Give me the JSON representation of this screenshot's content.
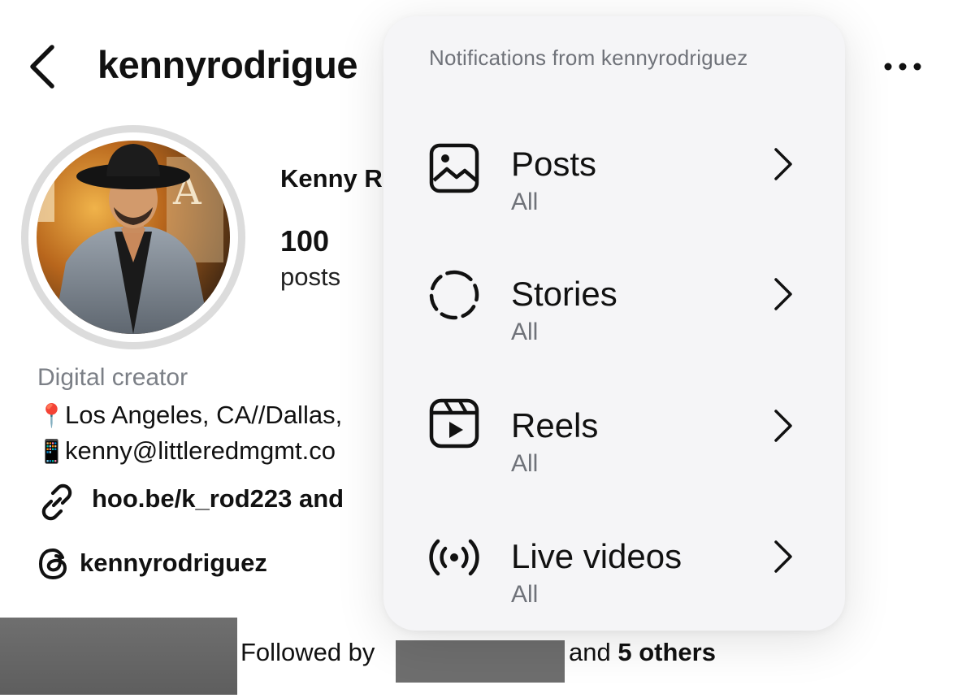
{
  "header": {
    "back_icon": "chevron-left-icon",
    "username": "kennyrodrigue",
    "more_icon": "more-horizontal-icon"
  },
  "profile": {
    "display_name": "Kenny R",
    "posts_count": "100",
    "posts_label": "posts",
    "category": "Digital creator",
    "bio_location_emoji": "📍",
    "bio_location": "Los Angeles, CA//Dallas,",
    "bio_email_emoji": "📱",
    "bio_email": "kenny@littleredmgmt.co",
    "link_text": "hoo.be/k_rod223 and",
    "threads_handle": "kennyrodriguez"
  },
  "followed_by": {
    "prefix": "Followed by",
    "and": "and",
    "others": "5 others"
  },
  "notifications": {
    "title": "Notifications from kennyrodriguez",
    "items": [
      {
        "label": "Posts",
        "value": "All",
        "icon": "image-icon"
      },
      {
        "label": "Stories",
        "value": "All",
        "icon": "dashed-circle-icon"
      },
      {
        "label": "Reels",
        "value": "All",
        "icon": "reels-icon"
      },
      {
        "label": "Live videos",
        "value": "All",
        "icon": "live-broadcast-icon"
      }
    ]
  },
  "colors": {
    "background": "#ffffff",
    "panel": "#f5f5f7",
    "secondary_text": "#6f7279",
    "redaction": "#6e6e6e"
  }
}
